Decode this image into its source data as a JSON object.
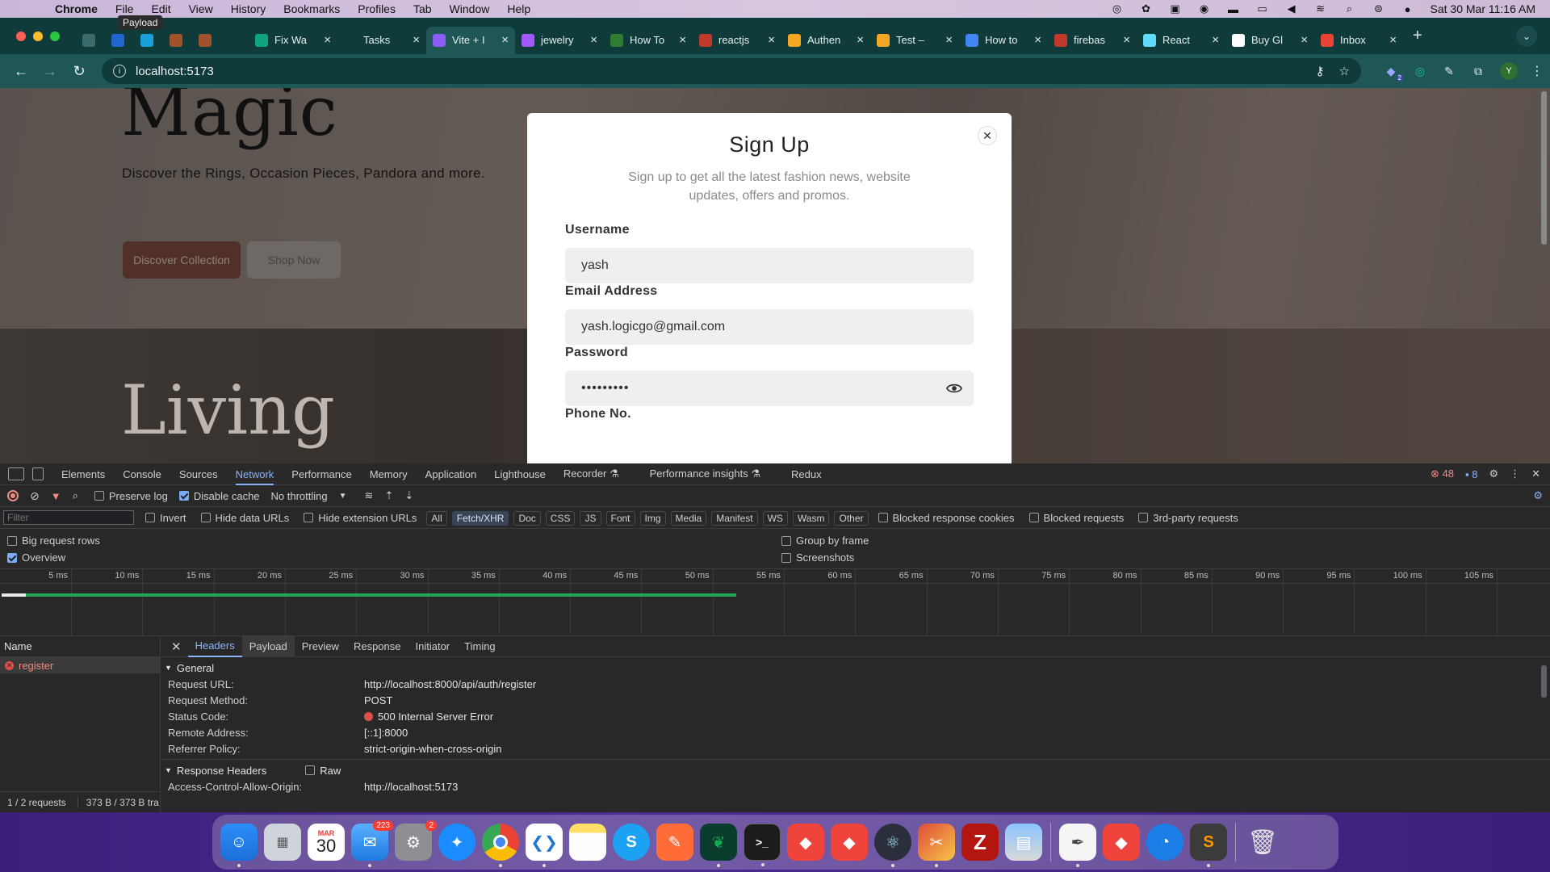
{
  "menubar": {
    "app": "Chrome",
    "items": [
      "File",
      "Edit",
      "View",
      "History",
      "Bookmarks",
      "Profiles",
      "Tab",
      "Window",
      "Help"
    ],
    "clock": "Sat 30 Mar  11:16 AM",
    "tooltip": "Payload"
  },
  "tabs": [
    {
      "title": "",
      "pinned": true,
      "color": "#3a6b6b",
      "icon": "globe-icon"
    },
    {
      "title": "",
      "pinned": true,
      "color": "#1f66d1",
      "icon": "jira-icon"
    },
    {
      "title": "",
      "pinned": true,
      "color": "#1aa0d8",
      "icon": "diamond-icon"
    },
    {
      "title": "",
      "pinned": true,
      "color": "#a0522d",
      "icon": "flag-icon"
    },
    {
      "title": "",
      "pinned": true,
      "color": "#a0522d",
      "icon": "flag-icon"
    },
    {
      "title": "",
      "pinned": true,
      "color": "#0f3b3b",
      "icon": "blank-icon"
    },
    {
      "title": "Fix Wa",
      "pinned": false,
      "color": "#10a37f",
      "icon": "chatgpt-icon"
    },
    {
      "title": "Tasks",
      "pinned": false,
      "color": "#0f3b3b",
      "icon": "task-icon"
    },
    {
      "title": "Vite + I",
      "pinned": false,
      "color": "#8b5cf6",
      "icon": "vite-icon",
      "active": true
    },
    {
      "title": "jewelry",
      "pinned": false,
      "color": "#a259ff",
      "icon": "figma-icon"
    },
    {
      "title": "How To",
      "pinned": false,
      "color": "#2e7d32",
      "icon": "w-icon"
    },
    {
      "title": "reactjs",
      "pinned": false,
      "color": "#c0392b",
      "icon": "stack-icon"
    },
    {
      "title": "Authen",
      "pinned": false,
      "color": "#f5a623",
      "icon": "firebase-icon"
    },
    {
      "title": "Test –",
      "pinned": false,
      "color": "#f5a623",
      "icon": "firebase-icon"
    },
    {
      "title": "How to",
      "pinned": false,
      "color": "#4285f4",
      "icon": "google-icon"
    },
    {
      "title": "firebas",
      "pinned": false,
      "color": "#c0392b",
      "icon": "stack-icon"
    },
    {
      "title": "React",
      "pinned": false,
      "color": "#61dafb",
      "icon": "react-icon"
    },
    {
      "title": "Buy Gl",
      "pinned": false,
      "color": "#ffffff",
      "icon": "shop-icon"
    },
    {
      "title": "Inbox",
      "pinned": false,
      "color": "#ea4335",
      "icon": "gmail-icon"
    }
  ],
  "toolbar": {
    "url": "localhost:5173",
    "avatar": "Y",
    "ext_badge": "2"
  },
  "page": {
    "hero_title": "Magic",
    "hero_tagline": "Discover the Rings, Occasion Pieces, Pandora and more.",
    "btn_discover": "Discover Collection",
    "btn_shop": "Shop Now",
    "hero2_title": "Living"
  },
  "modal": {
    "title": "Sign Up",
    "subtitle": "Sign up to get all the latest fashion news, website updates, offers and promos.",
    "username_label": "Username",
    "username_value": "yash",
    "email_label": "Email Address",
    "email_value": "yash.logicgo@gmail.com",
    "password_label": "Password",
    "password_value": "•••••••••",
    "phone_label": "Phone No."
  },
  "devtools": {
    "tabs": [
      "Elements",
      "Console",
      "Sources",
      "Network",
      "Performance",
      "Memory",
      "Application",
      "Lighthouse",
      "Recorder ⚗",
      "Performance insights ⚗",
      "Redux"
    ],
    "active_tab": "Network",
    "errors": "48",
    "messages": "8",
    "preserve_log": "Preserve log",
    "disable_cache": "Disable cache",
    "throttling": "No throttling",
    "filter_placeholder": "Filter",
    "invert": "Invert",
    "hide_data_urls": "Hide data URLs",
    "hide_ext_urls": "Hide extension URLs",
    "type_filters": [
      "All",
      "Fetch/XHR",
      "Doc",
      "CSS",
      "JS",
      "Font",
      "Img",
      "Media",
      "Manifest",
      "WS",
      "Wasm",
      "Other"
    ],
    "active_filter": "Fetch/XHR",
    "blocked_cookies": "Blocked response cookies",
    "blocked_requests": "Blocked requests",
    "third_party": "3rd-party requests",
    "big_rows": "Big request rows",
    "overview": "Overview",
    "group_by_frame": "Group by frame",
    "screenshots": "Screenshots",
    "timeline_ticks": [
      "5 ms",
      "10 ms",
      "15 ms",
      "20 ms",
      "25 ms",
      "30 ms",
      "35 ms",
      "40 ms",
      "45 ms",
      "50 ms",
      "55 ms",
      "60 ms",
      "65 ms",
      "70 ms",
      "75 ms",
      "80 ms",
      "85 ms",
      "90 ms",
      "95 ms",
      "100 ms",
      "105 ms"
    ],
    "name_header": "Name",
    "request_name": "register",
    "footer_requests": "1 / 2 requests",
    "footer_transfer": "373 B / 373 B tra",
    "detail_tabs": [
      "Headers",
      "Payload",
      "Preview",
      "Response",
      "Initiator",
      "Timing"
    ],
    "detail_active": "Headers",
    "general_title": "General",
    "general": [
      {
        "k": "Request URL:",
        "v": "http://localhost:8000/api/auth/register"
      },
      {
        "k": "Request Method:",
        "v": "POST"
      },
      {
        "k": "Status Code:",
        "v": "500 Internal Server Error",
        "error": true
      },
      {
        "k": "Remote Address:",
        "v": "[::1]:8000"
      },
      {
        "k": "Referrer Policy:",
        "v": "strict-origin-when-cross-origin"
      }
    ],
    "response_headers_title": "Response Headers",
    "raw_label": "Raw",
    "response_headers": [
      {
        "k": "Access-Control-Allow-Origin:",
        "v": "http://localhost:5173"
      }
    ]
  },
  "dock": {
    "calendar_month": "MAR",
    "calendar_day": "30",
    "mail_badge": "223",
    "settings_badge": "2",
    "apps": [
      "Finder",
      "Launchpad",
      "Calendar",
      "Mail",
      "System Settings",
      "Safari",
      "Chrome",
      "VS Code",
      "Notes",
      "Skype",
      "Postman",
      "MongoDB Compass",
      "Terminal",
      "AnyDesk",
      "AnyDesk",
      "Electron",
      "Photo Booth",
      "FileZilla",
      "Preview",
      "TextEdit",
      "AnyDesk",
      "Safari Network",
      "Sublime Text",
      "Trash"
    ]
  }
}
